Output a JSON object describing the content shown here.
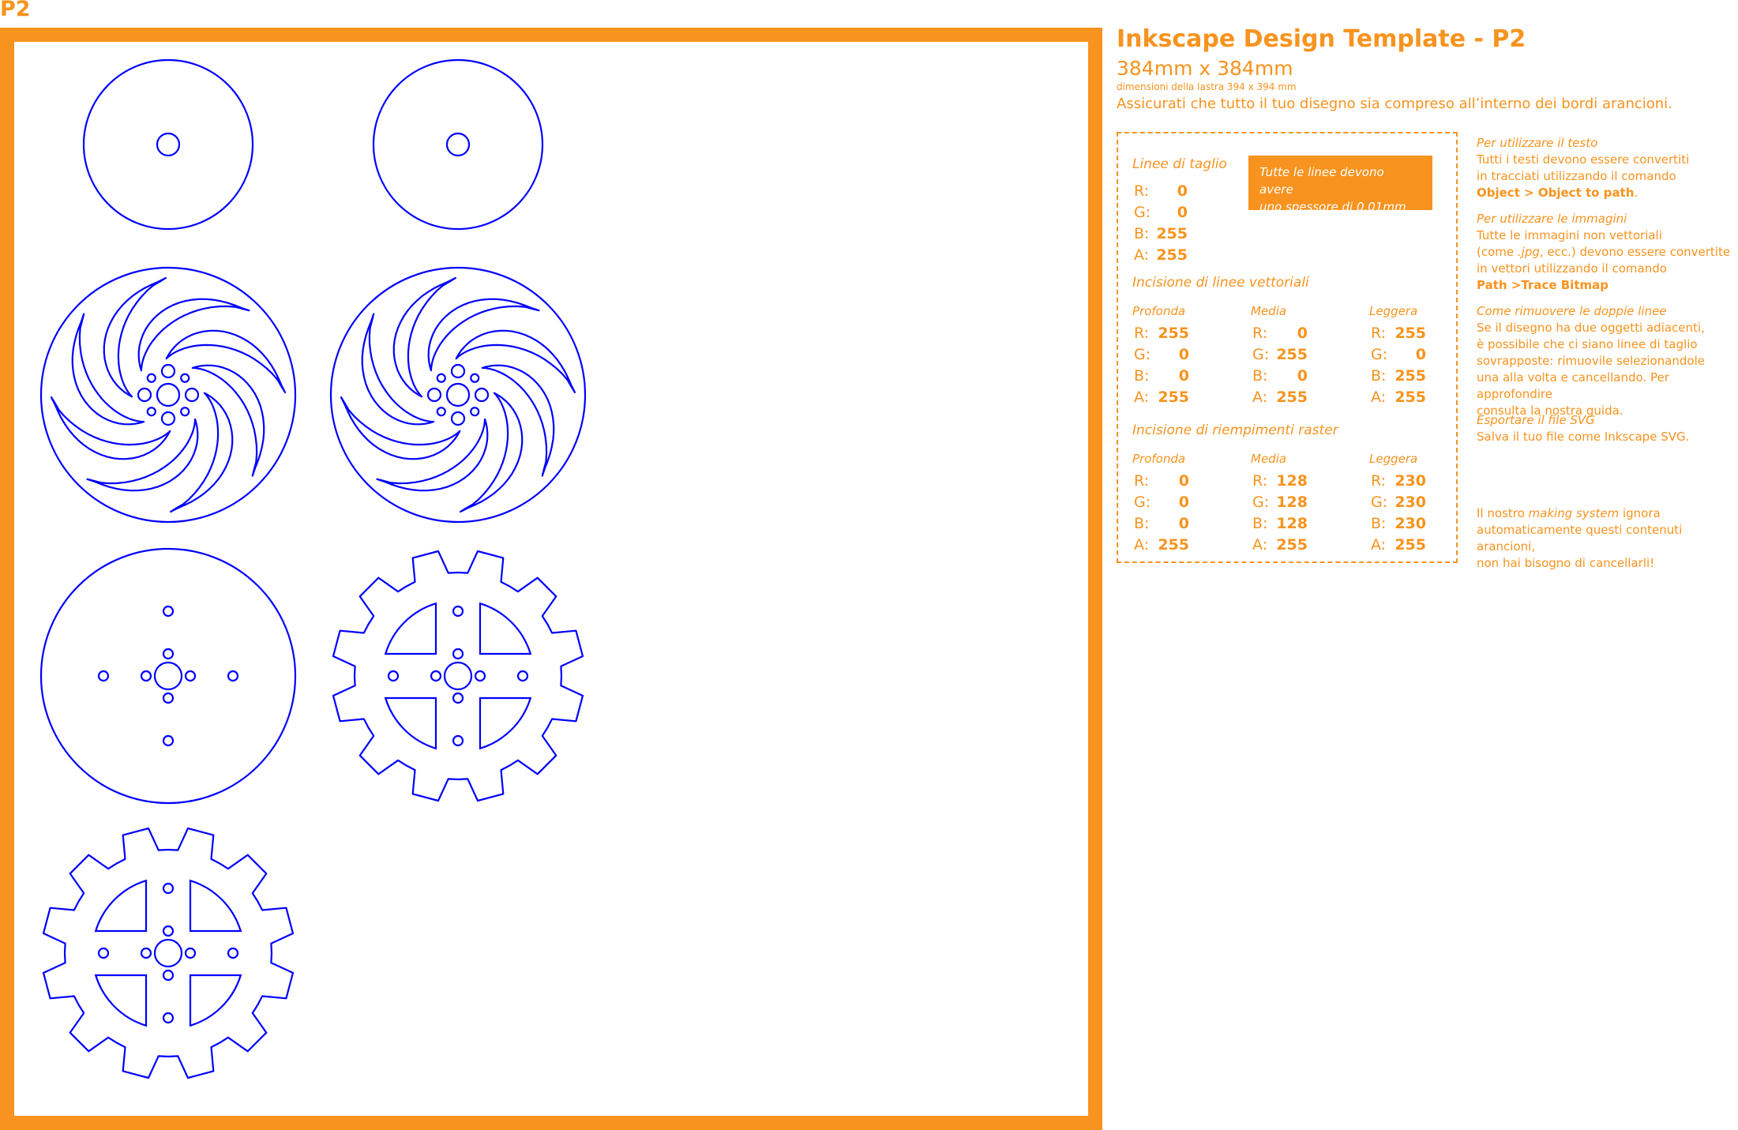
{
  "sheet_label": "P2",
  "colors": {
    "frame": "#F7931E",
    "cut_line": "#0000FF",
    "background": "#FFFFFF"
  },
  "info": {
    "title": "Inkscape Design Template - P2",
    "size": "384mm x 384mm",
    "plate": "dimensioni della lastra 394 x 394 mm",
    "warning": "Assicurati che tutto il tuo disegno sia compreso all’interno dei bordi arancioni."
  },
  "cut": {
    "heading": "Linee di taglio",
    "labels": [
      "R:",
      "G:",
      "B:",
      "A:"
    ],
    "values": [
      "0",
      "0",
      "255",
      "255"
    ],
    "note_line1": "Tutte le linee devono avere",
    "note_line2": "uno spessore di 0.01mm"
  },
  "vector": {
    "heading": "Incisione di linee vettoriali",
    "columns": [
      {
        "name": "Profonda",
        "values": [
          "255",
          "0",
          "0",
          "255"
        ]
      },
      {
        "name": "Media",
        "values": [
          "0",
          "255",
          "0",
          "255"
        ]
      },
      {
        "name": "Leggera",
        "values": [
          "255",
          "0",
          "255",
          "255"
        ]
      }
    ]
  },
  "raster": {
    "heading": "Incisione di riempimenti raster",
    "columns": [
      {
        "name": "Profonda",
        "values": [
          "0",
          "0",
          "0",
          "255"
        ]
      },
      {
        "name": "Media",
        "values": [
          "128",
          "128",
          "128",
          "255"
        ]
      },
      {
        "name": "Leggera",
        "values": [
          "230",
          "230",
          "230",
          "255"
        ]
      }
    ]
  },
  "sidebar": {
    "text": {
      "heading": "Per utilizzare il testo",
      "line1": "Tutti i testi devono essere convertiti",
      "line2": "in tracciati utilizzando il comando",
      "command": "Object > Object to path",
      "end": "."
    },
    "images": {
      "heading": "Per utilizzare le immagini",
      "line1": "Tutte le immagini non vettoriali",
      "line2_a": "(come ",
      "line2_b": ".jpg",
      "line2_c": ", ecc.) devono essere convertite",
      "line3": "in vettori utilizzando il comando",
      "command": "Path >Trace Bitmap"
    },
    "double": {
      "heading": "Come rimuovere le doppie linee",
      "line1": "Se il disegno ha due oggetti adiacenti,",
      "line2": "è possibile che ci siano linee di taglio",
      "line3": "sovrapposte: rimuovile selezionandole",
      "line4": "una alla volta e cancellando. Per approfondire",
      "line5": "consulta la nostra guida."
    },
    "export": {
      "heading": "Esportare il file SVG",
      "line1": "Salva il tuo file come Inkscape SVG."
    },
    "footer": {
      "line1_a": "Il nostro ",
      "line1_b": "making system",
      "line1_c": " ignora",
      "line2": "automaticamente questi contenuti arancioni,",
      "line3": "non hai bisogno di cancellarli!"
    }
  }
}
